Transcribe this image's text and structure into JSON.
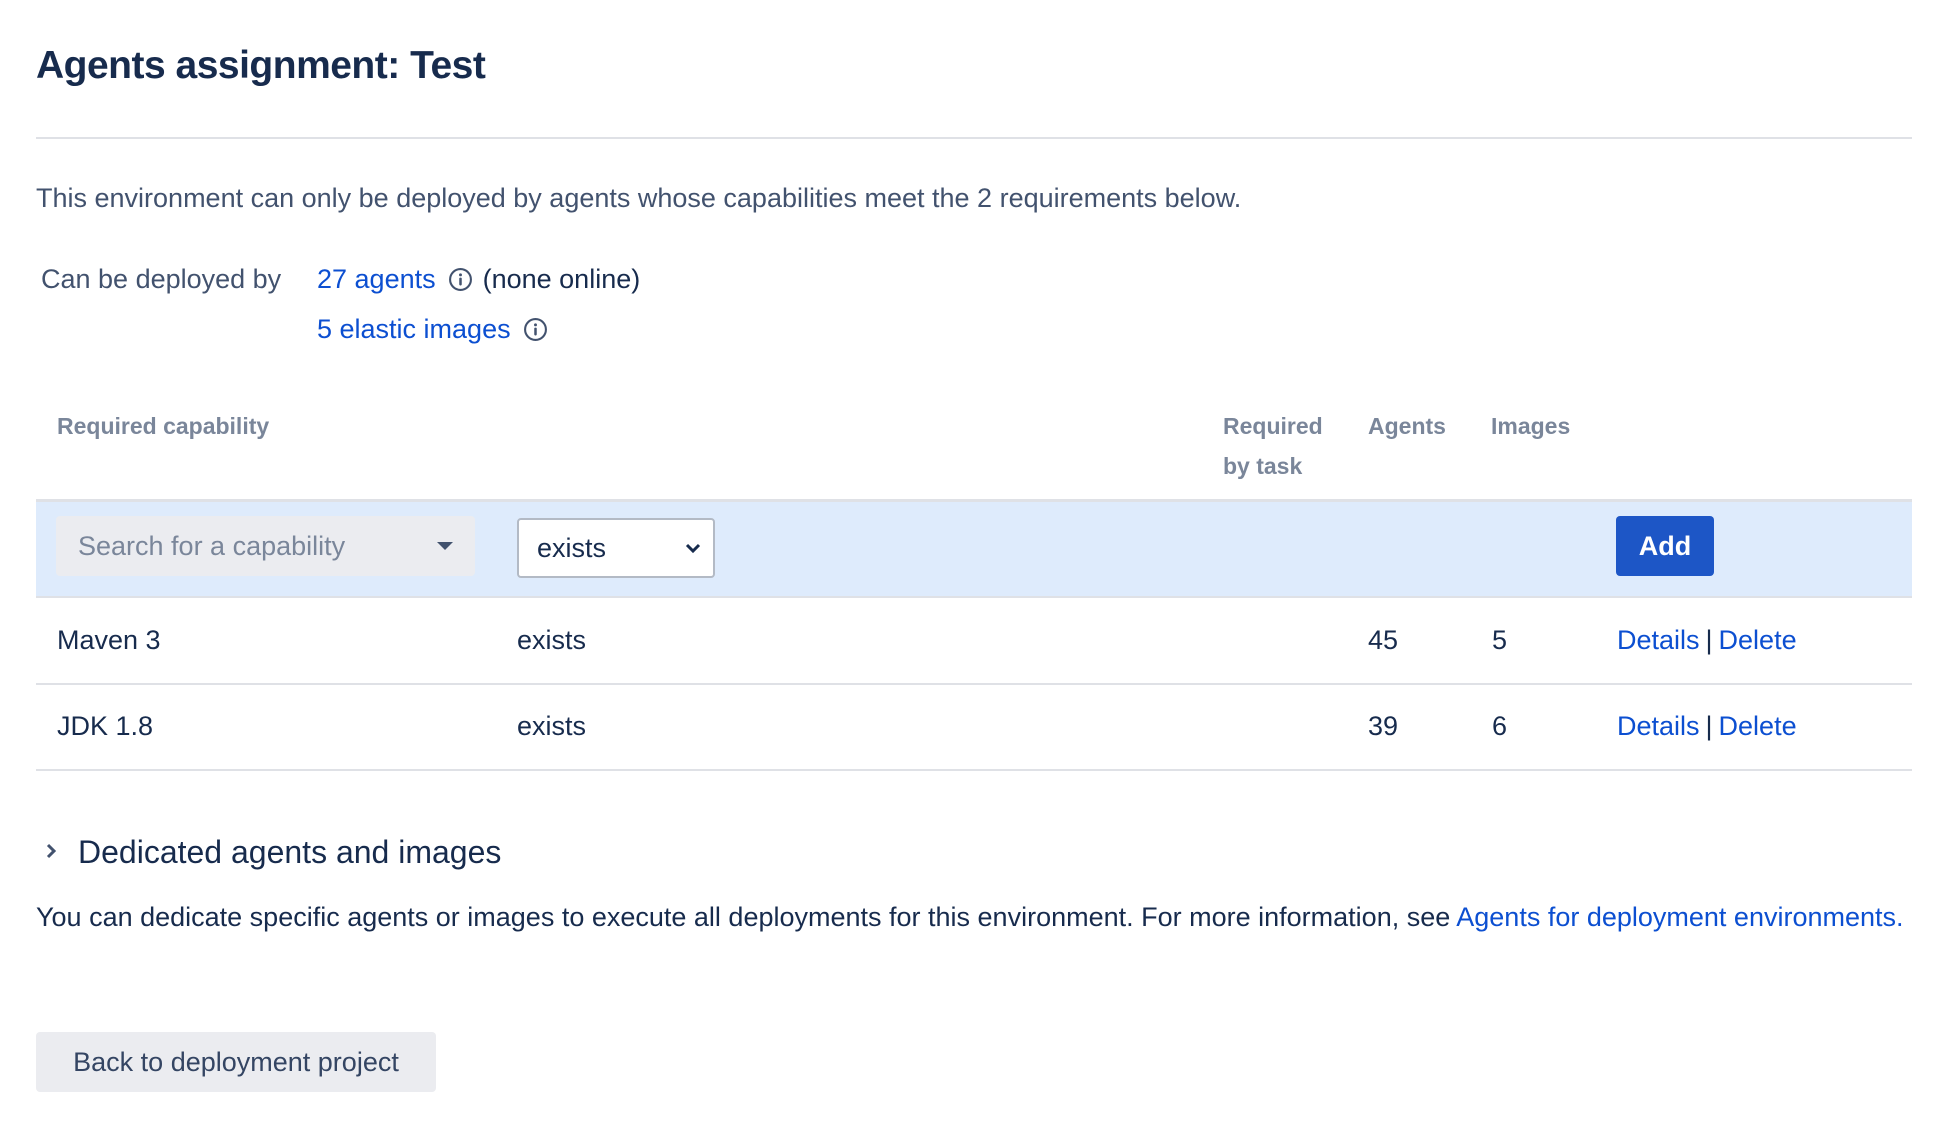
{
  "page": {
    "title": "Agents assignment: Test",
    "intro": "This environment can only be deployed by agents whose capabilities meet the 2 requirements below."
  },
  "deploy": {
    "label": "Can be deployed by",
    "agents_link": "27 agents",
    "agents_status": "(none online)",
    "images_link": "5 elastic images",
    "info_icon": "info-circle-icon"
  },
  "table": {
    "headers": {
      "capability": "Required capability",
      "required_by_task_line1": "Required",
      "required_by_task_line2": "by task",
      "agents": "Agents",
      "images": "Images"
    },
    "add_row": {
      "search_placeholder": "Search for a capability",
      "operator_selected": "exists",
      "add_label": "Add"
    },
    "rows": [
      {
        "capability": "Maven 3",
        "operator": "exists",
        "required_by_task": "",
        "agents": "45",
        "images": "5",
        "details_label": "Details",
        "separator": "|",
        "delete_label": "Delete"
      },
      {
        "capability": "JDK 1.8",
        "operator": "exists",
        "required_by_task": "",
        "agents": "39",
        "images": "6",
        "details_label": "Details",
        "separator": "|",
        "delete_label": "Delete"
      }
    ]
  },
  "dedicated": {
    "title": "Dedicated agents and images",
    "text": "You can dedicate specific agents or images to execute all deployments for this environment. For more information, see ",
    "link": "Agents for deployment environments."
  },
  "footer": {
    "back_label": "Back to deployment project"
  },
  "colors": {
    "link": "#0c4fd1",
    "primary_button": "#1d56c6",
    "add_row_bg": "#deebfc",
    "text": "#172b4d",
    "muted": "#7a869a"
  }
}
